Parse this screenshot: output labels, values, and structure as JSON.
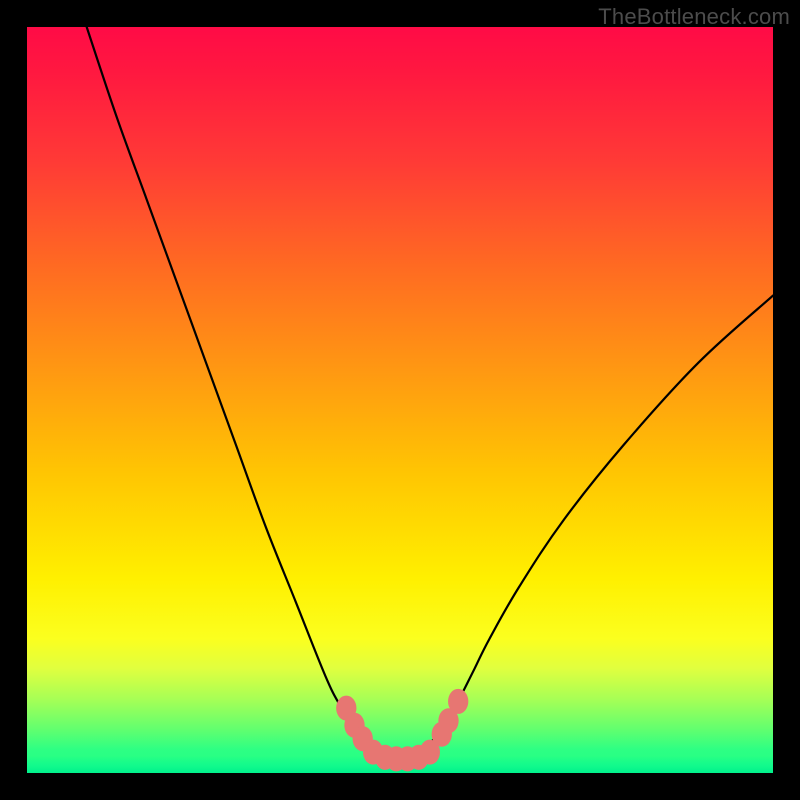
{
  "watermark": "TheBottleneck.com",
  "chart_data": {
    "type": "line",
    "title": "",
    "xlabel": "",
    "ylabel": "",
    "xlim": [
      0,
      100
    ],
    "ylim": [
      0,
      100
    ],
    "grid": false,
    "legend": false,
    "annotations": [],
    "series": [
      {
        "name": "bottleneck-curve",
        "color": "#000000",
        "x": [
          8,
          12,
          16,
          20,
          24,
          28,
          32,
          36,
          40,
          42,
          44,
          45,
          46,
          47,
          48,
          49,
          50,
          51,
          52,
          53,
          54,
          55,
          56,
          57,
          58,
          59,
          60,
          62,
          66,
          72,
          80,
          90,
          100
        ],
        "y": [
          100,
          88,
          77,
          66,
          55,
          44,
          33,
          23,
          13,
          9,
          6,
          5,
          4,
          3,
          2.4,
          2,
          1.9,
          2,
          2.4,
          3,
          4,
          5,
          6,
          8,
          10,
          12,
          14,
          18,
          25,
          34,
          44,
          55,
          64
        ]
      }
    ],
    "markers": [
      {
        "name": "pink-marker",
        "x": 42.8,
        "y": 8.7,
        "color": "#e77672",
        "r": 1.6
      },
      {
        "name": "pink-marker",
        "x": 43.9,
        "y": 6.4,
        "color": "#e77672",
        "r": 1.6
      },
      {
        "name": "pink-marker",
        "x": 45.0,
        "y": 4.6,
        "color": "#e77672",
        "r": 1.6
      },
      {
        "name": "pink-marker",
        "x": 46.4,
        "y": 2.8,
        "color": "#e77672",
        "r": 1.6
      },
      {
        "name": "pink-marker",
        "x": 48.0,
        "y": 2.1,
        "color": "#e77672",
        "r": 1.6
      },
      {
        "name": "pink-marker",
        "x": 49.5,
        "y": 1.9,
        "color": "#e77672",
        "r": 1.6
      },
      {
        "name": "pink-marker",
        "x": 51.0,
        "y": 1.9,
        "color": "#e77672",
        "r": 1.6
      },
      {
        "name": "pink-marker",
        "x": 52.5,
        "y": 2.1,
        "color": "#e77672",
        "r": 1.6
      },
      {
        "name": "pink-marker",
        "x": 54.0,
        "y": 2.8,
        "color": "#e77672",
        "r": 1.6
      },
      {
        "name": "pink-marker",
        "x": 55.6,
        "y": 5.2,
        "color": "#e77672",
        "r": 1.6
      },
      {
        "name": "pink-marker",
        "x": 56.5,
        "y": 7.0,
        "color": "#e77672",
        "r": 1.6
      },
      {
        "name": "pink-marker",
        "x": 57.8,
        "y": 9.6,
        "color": "#e77672",
        "r": 1.6
      }
    ],
    "background_gradient": {
      "direction": "vertical",
      "stops": [
        {
          "pos": 0,
          "color": "#ff0b46"
        },
        {
          "pos": 50,
          "color": "#ffb008"
        },
        {
          "pos": 78,
          "color": "#fff400"
        },
        {
          "pos": 100,
          "color": "#05f78e"
        }
      ]
    }
  }
}
